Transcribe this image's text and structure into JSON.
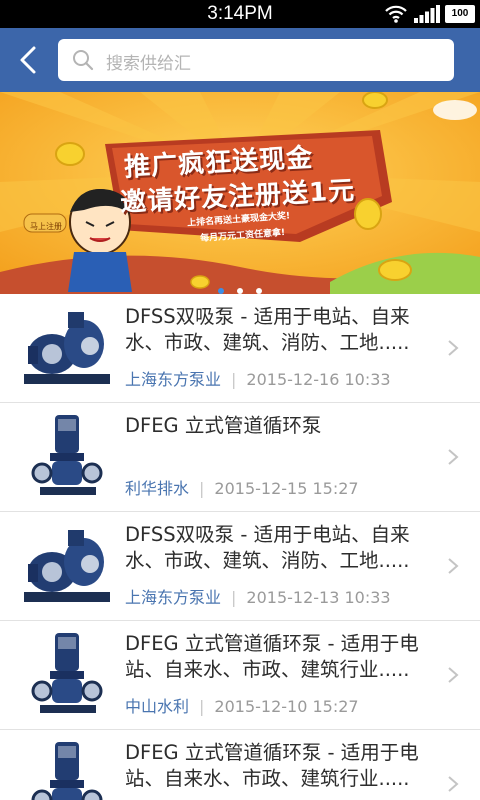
{
  "status_bar": {
    "time": "3:14PM",
    "battery": "100",
    "icons": [
      "wifi-icon",
      "signal-icon",
      "battery-icon"
    ]
  },
  "header": {
    "search_placeholder": "搜索供给汇",
    "back_icon": "back-icon",
    "search_icon": "search-icon",
    "color": "#3c66aa"
  },
  "banner": {
    "title_line1": "推广疯狂送现金",
    "title_line2": "邀请好友注册送1元",
    "sub_line1": "上排名再送土豪现金大奖!",
    "sub_line2": "每月万元工资任意拿!",
    "tag": "马上注册",
    "slides": 3,
    "active_slide": 0
  },
  "items": [
    {
      "title": "DFSS双吸泵 - 适用于电站、自来水、市政、建筑、消防、工地.....",
      "supplier": "上海东方泵业",
      "date": "2015-12-16  10:33",
      "thumb": "double-suction-pump"
    },
    {
      "title": "DFEG 立式管道循环泵",
      "supplier": "利华排水",
      "date": "2015-12-15  15:27",
      "thumb": "vertical-pipeline-pump"
    },
    {
      "title": "DFSS双吸泵 - 适用于电站、自来水、市政、建筑、消防、工地.....",
      "supplier": "上海东方泵业",
      "date": "2015-12-13  10:33",
      "thumb": "double-suction-pump"
    },
    {
      "title": "DFEG 立式管道循环泵 - 适用于电站、自来水、市政、建筑行业.....",
      "supplier": "中山水利",
      "date": "2015-12-10  15:27",
      "thumb": "vertical-pipeline-pump"
    },
    {
      "title": "DFEG 立式管道循环泵 - 适用于电站、自来水、市政、建筑行业.....",
      "supplier": "",
      "date": "",
      "thumb": "vertical-pipeline-pump"
    }
  ]
}
